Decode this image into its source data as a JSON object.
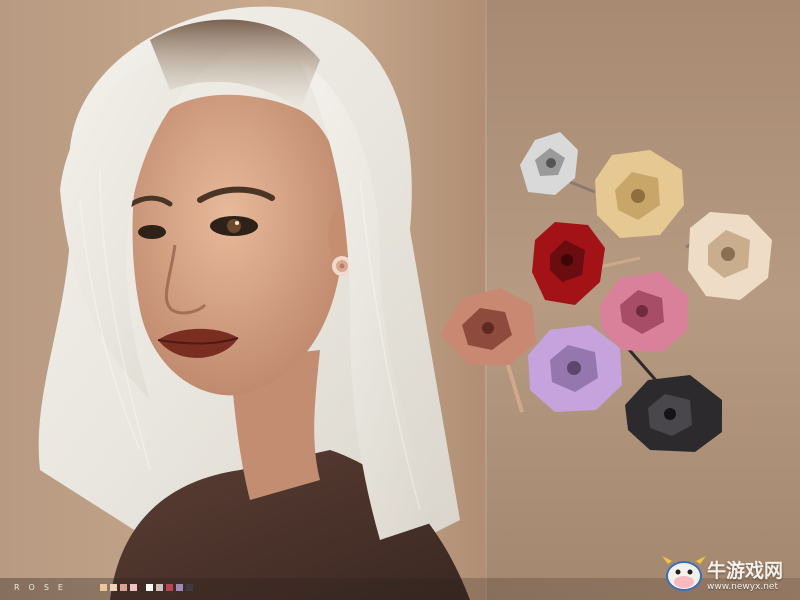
{
  "product": {
    "collection_label": "ROSE",
    "swatch_colors": [
      "#e9c89e",
      "#f0d2b4",
      "#d9a292",
      "#efc2c4",
      "#ffffff",
      "#d2bfbe",
      "#b8455b",
      "#9f88b8",
      "#3d3a40"
    ]
  },
  "watermark": {
    "site_name": "牛游戏网",
    "site_url": "www.newyx.net",
    "logo_icon": "cartoon-cow-icon"
  },
  "palette": {
    "background": "#c0a288",
    "rose_silver": "#d9d9d9",
    "rose_gold": "#e6c893",
    "rose_champagne": "#eedcc6",
    "rose_red": "#a31216",
    "rose_copper": "#c98872",
    "rose_pink": "#d9809a",
    "rose_lilac": "#c6a3dc",
    "rose_black": "#2c2a2d"
  }
}
